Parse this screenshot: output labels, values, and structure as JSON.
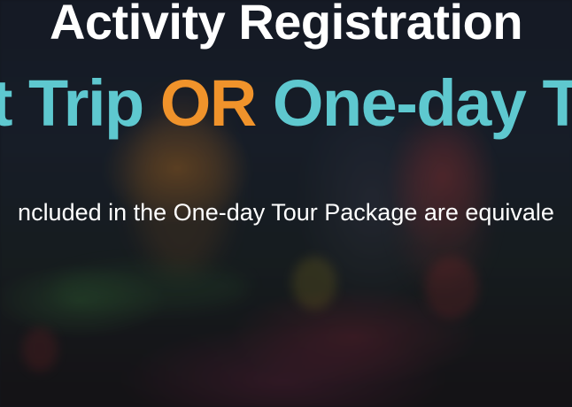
{
  "hero": {
    "title": "Activity Registration",
    "headline_part1": "Trip",
    "headline_prefix": "t",
    "headline_connector": "OR",
    "headline_part2": "One-day T",
    "subline": "ncluded in the One-day Tour Package are equivale",
    "colors": {
      "teal": "#5ec8cf",
      "orange": "#f0932b",
      "white": "#ffffff"
    }
  }
}
